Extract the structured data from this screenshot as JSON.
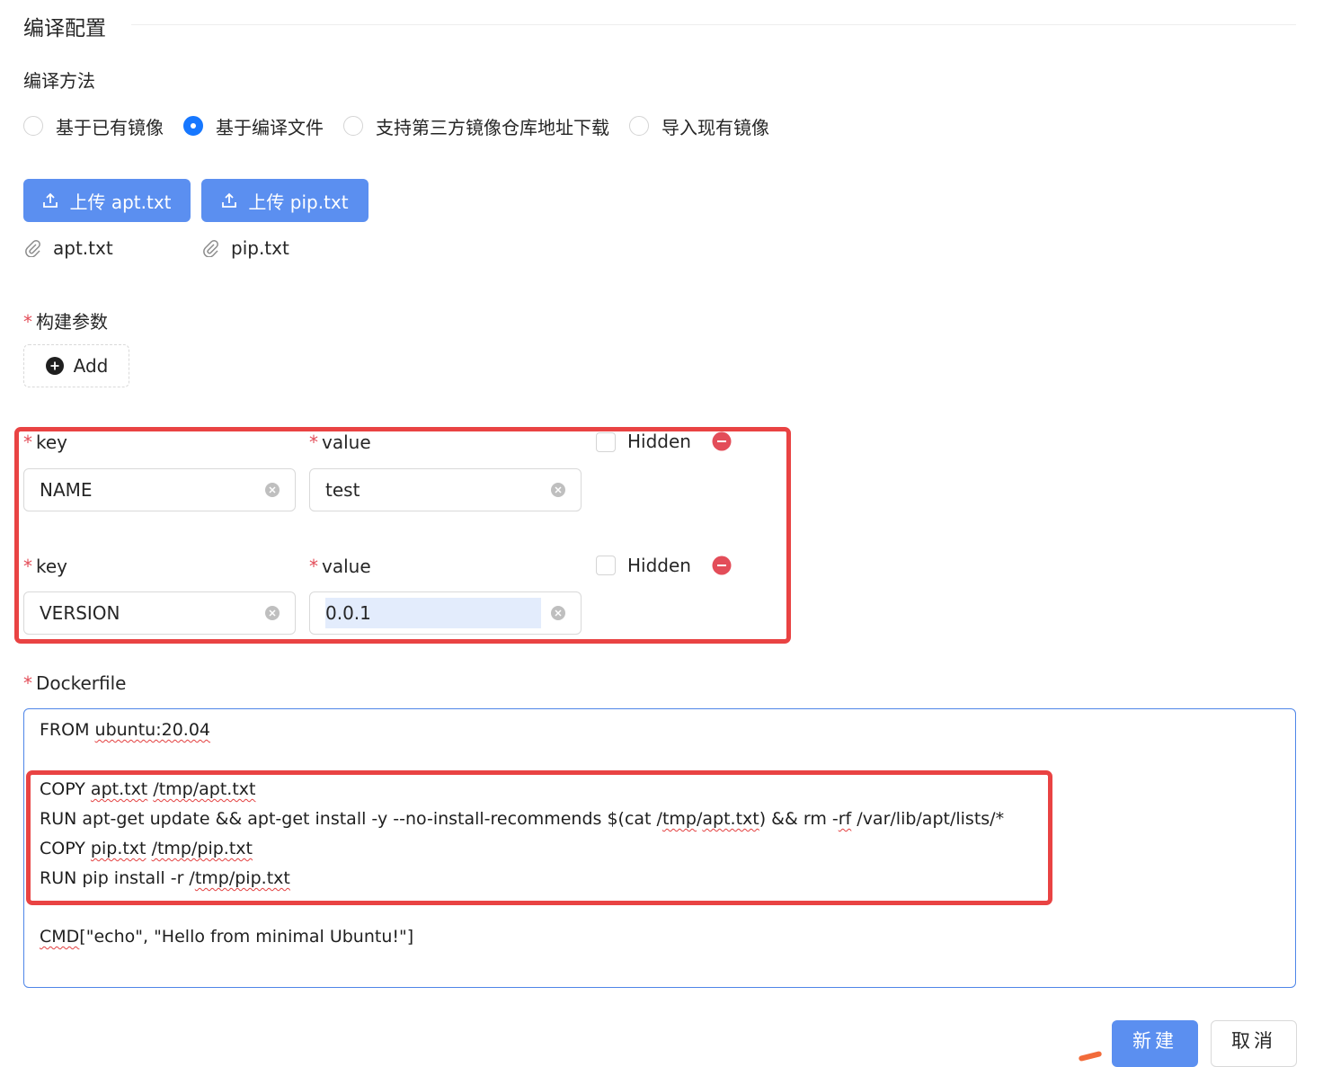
{
  "section": {
    "title": "编译配置"
  },
  "method": {
    "label": "编译方法",
    "options": [
      {
        "label": "基于已有镜像",
        "checked": false
      },
      {
        "label": "基于编译文件",
        "checked": true
      },
      {
        "label": "支持第三方镜像仓库地址下载",
        "checked": false
      },
      {
        "label": "导入现有镜像",
        "checked": false
      }
    ]
  },
  "uploads": {
    "apt_button": "上传 apt.txt",
    "pip_button": "上传 pip.txt",
    "apt_file": "apt.txt",
    "pip_file": "pip.txt"
  },
  "build_args": {
    "label": "构建参数",
    "add_label": "Add",
    "rows": [
      {
        "key_label": "key",
        "value_label": "value",
        "key": "NAME",
        "value": "test",
        "hidden_label": "Hidden"
      },
      {
        "key_label": "key",
        "value_label": "value",
        "key": "VERSION",
        "value": "0.0.1",
        "hidden_label": "Hidden"
      }
    ]
  },
  "dockerfile": {
    "label": "Dockerfile",
    "lines": {
      "l1a": "FROM ",
      "l1b": "ubuntu:20.04",
      "l2a": "COPY ",
      "l2b": "apt.txt",
      "l2c": " ",
      "l2d": "/tmp/apt.txt",
      "l3a": "RUN apt-get update && apt-get install -y --no-install-recommends $(cat /",
      "l3b": "tmp",
      "l3c": "/",
      "l3d": "apt.txt",
      "l3e": ") && rm -",
      "l3f": "rf",
      "l3g": " /var/lib/apt/lists/*",
      "l4a": "COPY ",
      "l4b": "pip.txt",
      "l4c": " ",
      "l4d": "/tmp/pip.txt",
      "l5a": "RUN pip install -r /",
      "l5b": "tmp/pip.txt",
      "l6a": "CMD",
      "l6b": "[\"echo\", \"Hello from minimal Ubuntu!\"]"
    }
  },
  "footer": {
    "create": "新建",
    "cancel": "取消"
  },
  "colors": {
    "primary": "#5b8ff0",
    "danger": "#e34d59",
    "highlight": "#e94343"
  }
}
